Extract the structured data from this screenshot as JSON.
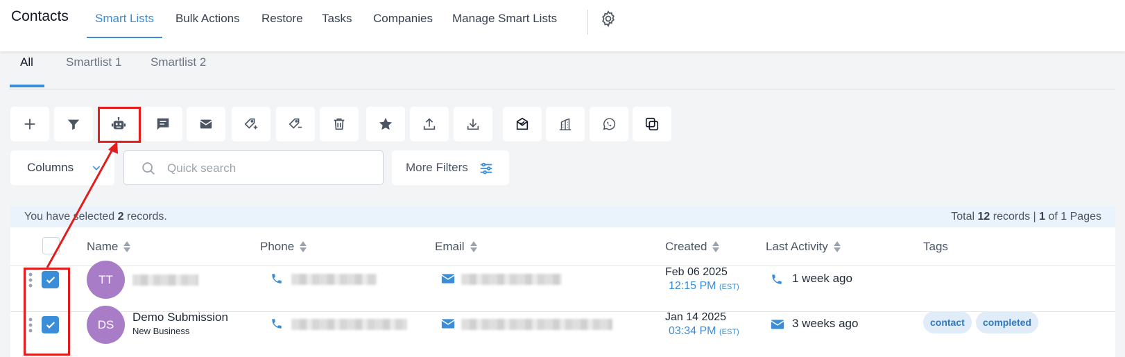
{
  "app": {
    "title": "Contacts"
  },
  "nav": {
    "tabs": [
      {
        "label": "Smart Lists"
      },
      {
        "label": "Bulk Actions"
      },
      {
        "label": "Restore"
      },
      {
        "label": "Tasks"
      },
      {
        "label": "Companies"
      },
      {
        "label": "Manage Smart Lists"
      }
    ],
    "active_tab": "Smart Lists",
    "settings_icon": "gear-icon"
  },
  "smartlists": {
    "tabs": [
      {
        "label": "All"
      },
      {
        "label": "Smartlist 1"
      },
      {
        "label": "Smartlist 2"
      }
    ],
    "active": "All"
  },
  "toolbar": {
    "buttons": [
      {
        "icon": "plus-icon"
      },
      {
        "icon": "filter-icon"
      },
      {
        "icon": "robot-icon"
      },
      {
        "icon": "message-icon"
      },
      {
        "icon": "email-icon"
      },
      {
        "icon": "tag-add-icon"
      },
      {
        "icon": "tag-remove-icon"
      },
      {
        "icon": "trash-icon"
      },
      {
        "icon": "star-icon"
      },
      {
        "icon": "upload-icon"
      },
      {
        "icon": "download-icon"
      },
      {
        "icon": "review-request-icon"
      },
      {
        "icon": "company-icon"
      },
      {
        "icon": "whatsapp-icon"
      },
      {
        "icon": "duplicate-icon"
      }
    ],
    "highlighted": "robot-icon"
  },
  "controls": {
    "columns_label": "Columns",
    "search_placeholder": "Quick search",
    "more_filters_label": "More Filters"
  },
  "selection": {
    "prefix": "You have selected",
    "count": "2",
    "suffix": "records.",
    "total_prefix": "Total",
    "total": "12",
    "total_suffix": "records |",
    "page": "1",
    "pages_suffix": "of 1 Pages"
  },
  "table": {
    "columns": [
      {
        "label": "Name"
      },
      {
        "label": "Phone"
      },
      {
        "label": "Email"
      },
      {
        "label": "Created"
      },
      {
        "label": "Last Activity"
      },
      {
        "label": "Tags"
      }
    ],
    "rows": [
      {
        "initials": "TT",
        "name": "",
        "company": "",
        "created_date": "Feb 06 2025",
        "created_time": "12:15 PM",
        "tz": "(EST)",
        "activity": "1 week ago",
        "activity_icon": "phone-icon",
        "tags": [],
        "checked": true
      },
      {
        "initials": "DS",
        "name": "Demo Submission",
        "company": "New Business",
        "created_date": "Jan 14 2025",
        "created_time": "03:34 PM",
        "tz": "(EST)",
        "activity": "3 weeks ago",
        "activity_icon": "email-icon",
        "tags": [
          "contact",
          "completed"
        ],
        "checked": true
      }
    ]
  },
  "colors": {
    "accent": "#3a8dd6",
    "avatar": "#a87cc7",
    "highlight": "#e11d1d",
    "selection_bg": "#eaf2fb",
    "tag_bg": "#e0edf9"
  }
}
